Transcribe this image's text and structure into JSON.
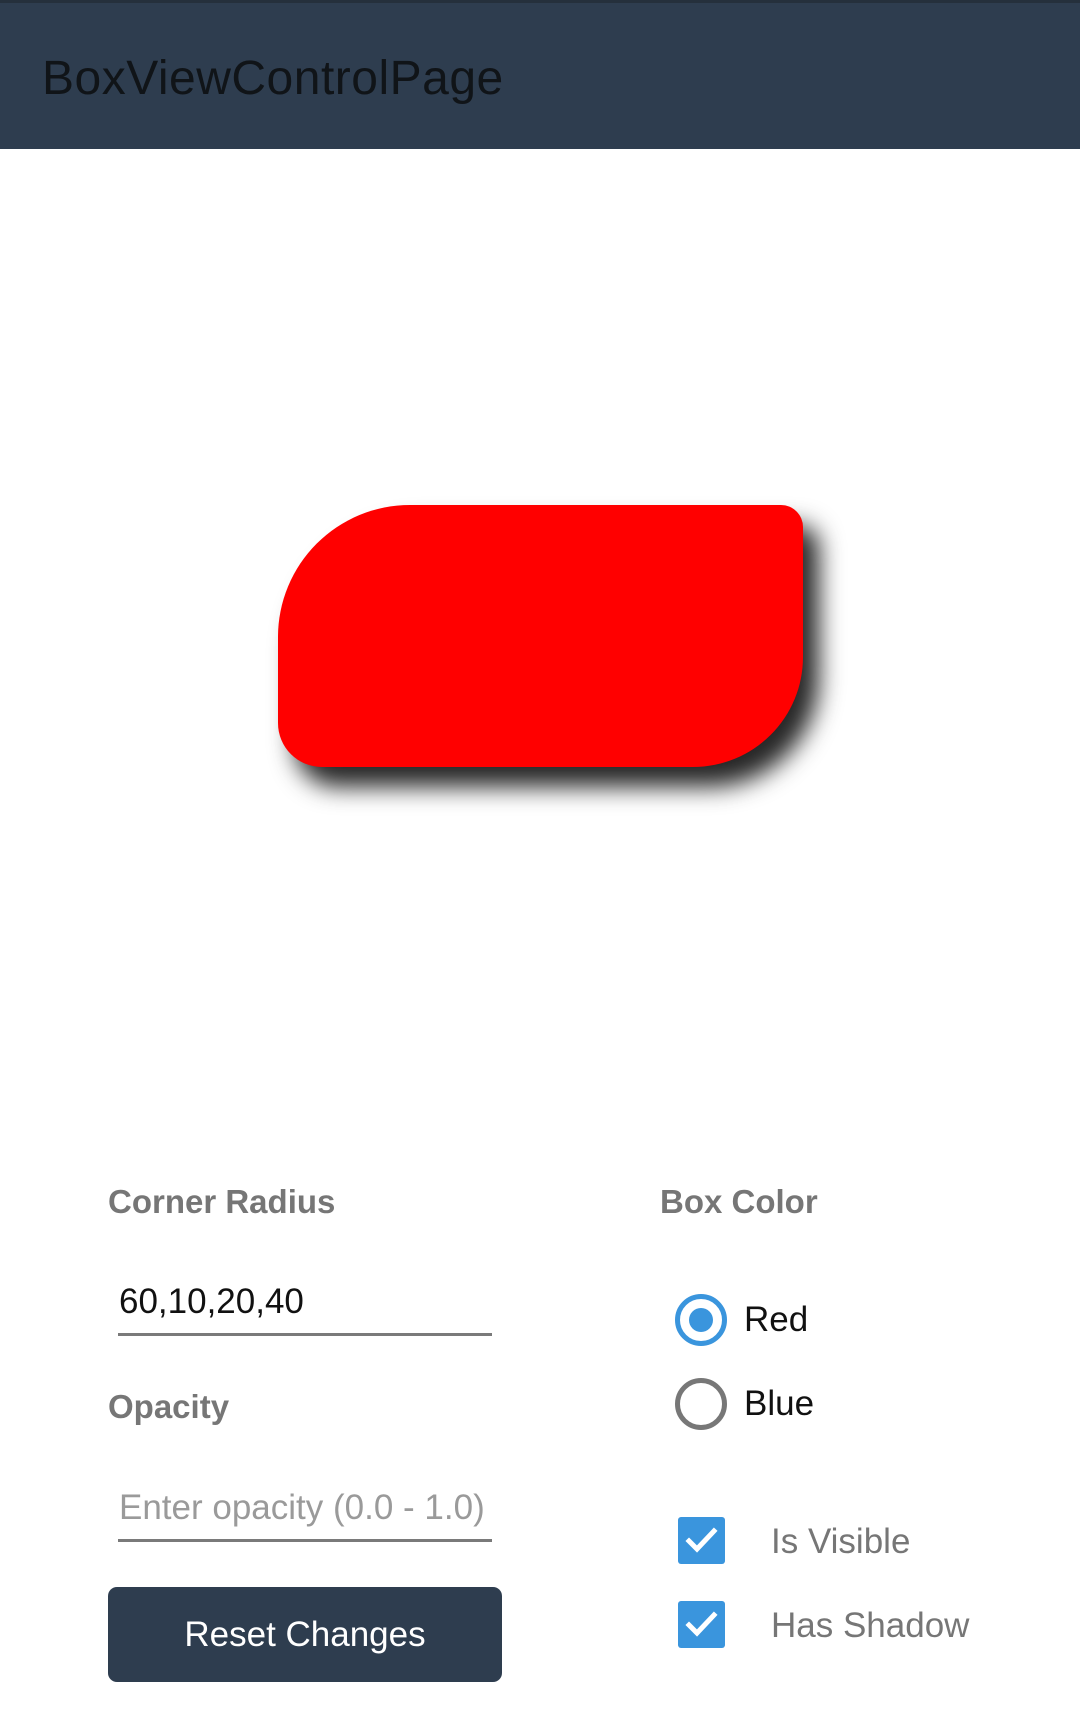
{
  "appbar": {
    "title": "BoxViewControlPage"
  },
  "preview": {
    "color": "#ff0000"
  },
  "corner_radius": {
    "label": "Corner Radius",
    "value": "60,10,20,40"
  },
  "opacity": {
    "label": "Opacity",
    "placeholder": "Enter opacity (0.0 - 1.0)",
    "value": ""
  },
  "reset_button": {
    "label": "Reset Changes"
  },
  "box_color": {
    "label": "Box Color",
    "options": [
      {
        "label": "Red",
        "selected": true
      },
      {
        "label": "Blue",
        "selected": false
      }
    ]
  },
  "toggles": {
    "is_visible": {
      "label": "Is Visible",
      "checked": true
    },
    "has_shadow": {
      "label": "Has Shadow",
      "checked": true
    }
  },
  "colors": {
    "appbar": "#2e3d4f",
    "accent": "#3a95dd",
    "label_gray": "#767676"
  }
}
